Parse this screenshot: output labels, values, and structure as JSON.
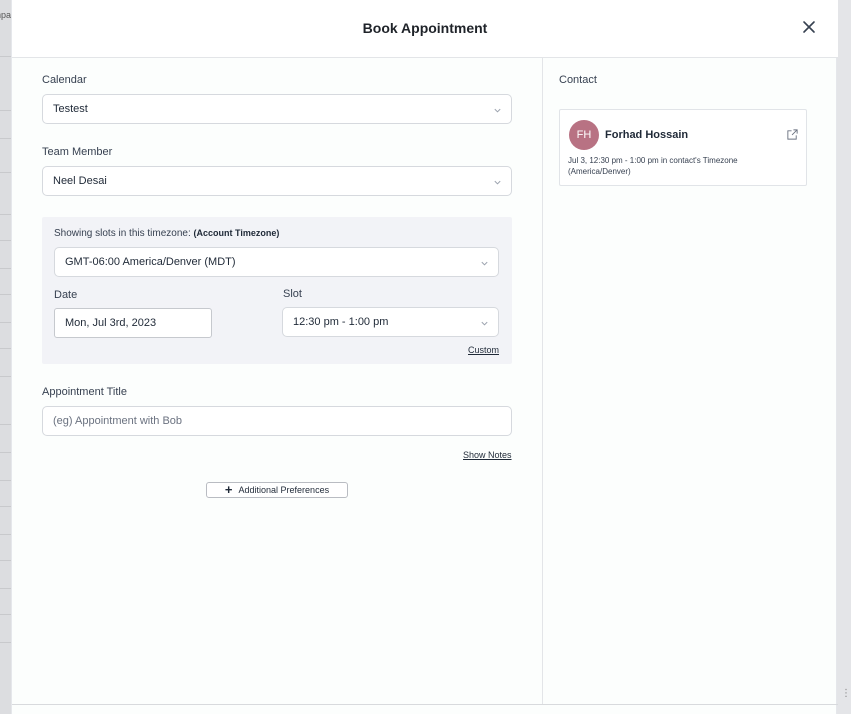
{
  "background": {
    "edge_text": "npa"
  },
  "modal": {
    "title": "Book Appointment"
  },
  "form": {
    "calendar": {
      "label": "Calendar",
      "value": "Testest"
    },
    "team_member": {
      "label": "Team Member",
      "value": "Neel Desai"
    },
    "timezone": {
      "label": "Showing slots in this timezone:",
      "label_note": "(Account Timezone)",
      "value": "GMT-06:00 America/Denver (MDT)"
    },
    "date": {
      "label": "Date",
      "value": "Mon, Jul 3rd, 2023"
    },
    "slot": {
      "label": "Slot",
      "value": "12:30 pm - 1:00 pm"
    },
    "custom_link": "Custom",
    "appointment_title": {
      "label": "Appointment Title",
      "placeholder": "(eg) Appointment with Bob"
    },
    "show_notes_link": "Show Notes",
    "additional_preferences_label": "Additional Preferences"
  },
  "contact": {
    "section_label": "Contact",
    "initials": "FH",
    "name": "Forhad Hossain",
    "meta": "Jul 3, 12:30 pm - 1:00 pm in contact's Timezone (America/Denver)",
    "avatar_color": "#b87283"
  }
}
